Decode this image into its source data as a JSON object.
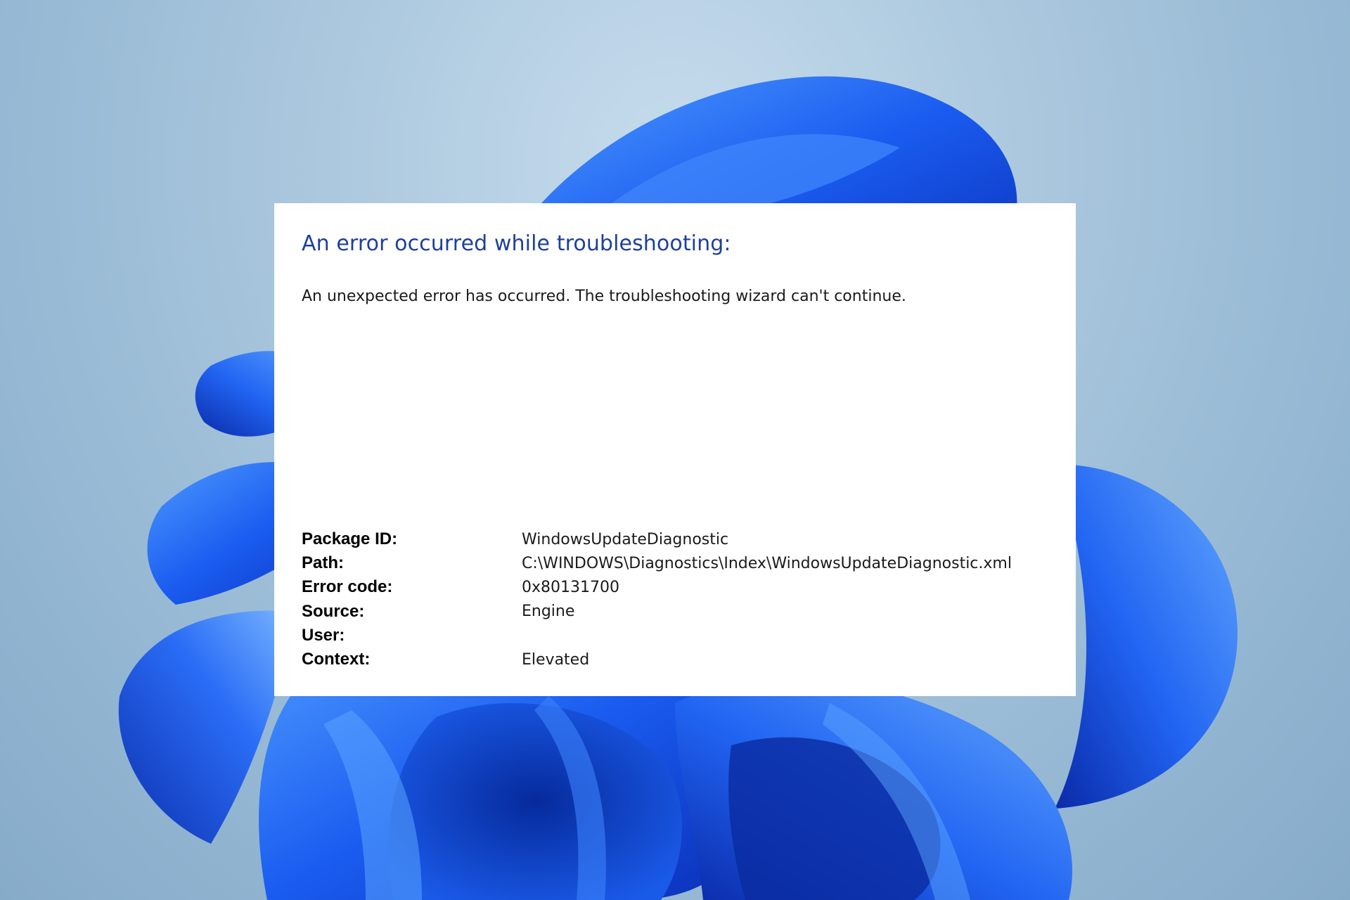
{
  "wallpaper": {
    "background_color": "#a9c6dd",
    "bloom_color": "#1a5cf0",
    "description_icon": "windows-11-bloom"
  },
  "dialog": {
    "title": "An error occurred while troubleshooting:",
    "message": "An unexpected error has occurred. The troubleshooting wizard can't continue.",
    "title_color": "#1e3f9c",
    "details": [
      {
        "label": "Package ID:",
        "value": "WindowsUpdateDiagnostic"
      },
      {
        "label": "Path:",
        "value": "C:\\WINDOWS\\Diagnostics\\Index\\WindowsUpdateDiagnostic.xml"
      },
      {
        "label": "Error code:",
        "value": "0x80131700"
      },
      {
        "label": "Source:",
        "value": "Engine"
      },
      {
        "label": "User:",
        "value": ""
      },
      {
        "label": "Context:",
        "value": "Elevated"
      }
    ]
  }
}
